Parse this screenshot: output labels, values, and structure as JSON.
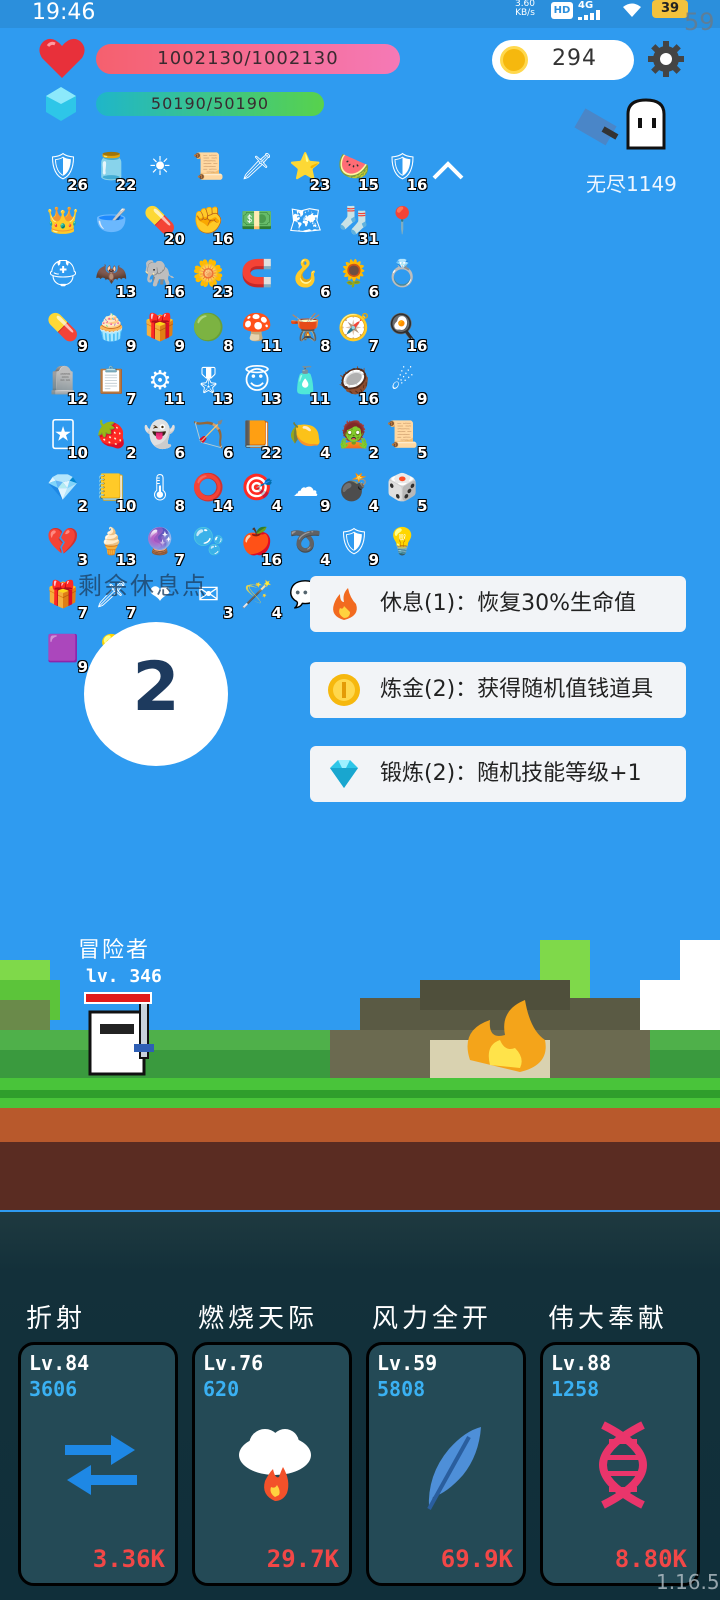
{
  "status_bar": {
    "time": "19:46",
    "net_speed": "3.60 KB/s",
    "hd": "HD",
    "network": "4G",
    "battery": "39",
    "fps": "59"
  },
  "player": {
    "hp": "1002130/1002130",
    "mp": "50190/50190",
    "coins": "294",
    "endless_label": "无尽1149"
  },
  "items": [
    {
      "icon": "shield-round-icon",
      "glyph": "🛡",
      "count": "26"
    },
    {
      "icon": "jam-jar-icon",
      "glyph": "🫙",
      "count": "22"
    },
    {
      "icon": "sun-icon",
      "glyph": "☀",
      "count": ""
    },
    {
      "icon": "scroll-icon",
      "glyph": "📜",
      "count": ""
    },
    {
      "icon": "sword-icon",
      "glyph": "🗡",
      "count": ""
    },
    {
      "icon": "star-card-icon",
      "glyph": "⭐",
      "count": "23"
    },
    {
      "icon": "watermelon-icon",
      "glyph": "🍉",
      "count": "15"
    },
    {
      "icon": "shield-icon",
      "glyph": "🛡",
      "count": "16"
    },
    {
      "icon": "crown-icon",
      "glyph": "👑",
      "count": ""
    },
    {
      "icon": "mortar-icon",
      "glyph": "🥣",
      "count": ""
    },
    {
      "icon": "capsule-icon",
      "glyph": "💊",
      "count": "20"
    },
    {
      "icon": "fist-icon",
      "glyph": "✊",
      "count": "16"
    },
    {
      "icon": "money-icon",
      "glyph": "💵",
      "count": ""
    },
    {
      "icon": "map-icon",
      "glyph": "🗺",
      "count": ""
    },
    {
      "icon": "sock-icon",
      "glyph": "🧦",
      "count": "31"
    },
    {
      "icon": "location-pin-icon",
      "glyph": "📍",
      "count": ""
    },
    {
      "icon": "helmet-icon",
      "glyph": "⛑",
      "count": ""
    },
    {
      "icon": "bat-icon",
      "glyph": "🦇",
      "count": "13"
    },
    {
      "icon": "elephant-icon",
      "glyph": "🐘",
      "count": "16"
    },
    {
      "icon": "flower-icon",
      "glyph": "🌼",
      "count": "23"
    },
    {
      "icon": "magnet-icon",
      "glyph": "🧲",
      "count": ""
    },
    {
      "icon": "hook-icon",
      "glyph": "🪝",
      "count": "6"
    },
    {
      "icon": "sunflower-icon",
      "glyph": "🌻",
      "count": "6"
    },
    {
      "icon": "ring-icon",
      "glyph": "💍",
      "count": ""
    },
    {
      "icon": "pill-icon",
      "glyph": "💊",
      "count": "9"
    },
    {
      "icon": "cupcake-icon",
      "glyph": "🧁",
      "count": "9"
    },
    {
      "icon": "purple-box-icon",
      "glyph": "🎁",
      "count": "9"
    },
    {
      "icon": "green-figure-icon",
      "glyph": "🟢",
      "count": "8"
    },
    {
      "icon": "mushroom-icon",
      "glyph": "🍄",
      "count": "11"
    },
    {
      "icon": "cauldron-icon",
      "glyph": "🫕",
      "count": "8"
    },
    {
      "icon": "compass-icon",
      "glyph": "🧭",
      "count": "7"
    },
    {
      "icon": "egg-icon",
      "glyph": "🍳",
      "count": "16"
    },
    {
      "icon": "tombstone-icon",
      "glyph": "🪦",
      "count": "12"
    },
    {
      "icon": "clipboard-icon",
      "glyph": "📋",
      "count": "7"
    },
    {
      "icon": "mace-icon",
      "glyph": "⚙",
      "count": "11"
    },
    {
      "icon": "badge-icon",
      "glyph": "🎖",
      "count": "13"
    },
    {
      "icon": "halo-icon",
      "glyph": "😇",
      "count": "13"
    },
    {
      "icon": "potion-bottle-icon",
      "glyph": "🧴",
      "count": "11"
    },
    {
      "icon": "coconut-icon",
      "glyph": "🥥",
      "count": "16"
    },
    {
      "icon": "meteor-icon",
      "glyph": "☄",
      "count": "9"
    },
    {
      "icon": "card-icon",
      "glyph": "🃏",
      "count": "10"
    },
    {
      "icon": "strawberry-icon",
      "glyph": "🍓",
      "count": "2"
    },
    {
      "icon": "ghost-icon",
      "glyph": "👻",
      "count": "6"
    },
    {
      "icon": "bow-icon",
      "glyph": "🏹",
      "count": "6"
    },
    {
      "icon": "book-icon",
      "glyph": "📙",
      "count": "22"
    },
    {
      "icon": "lime-icon",
      "glyph": "🍋",
      "count": "4"
    },
    {
      "icon": "zombie-icon",
      "glyph": "🧟",
      "count": "2"
    },
    {
      "icon": "blue-scroll-icon",
      "glyph": "📜",
      "count": "5"
    },
    {
      "icon": "gem-icon",
      "glyph": "💎",
      "count": "2"
    },
    {
      "icon": "note-icon",
      "glyph": "📒",
      "count": "10"
    },
    {
      "icon": "thermometer-icon",
      "glyph": "🌡",
      "count": "8"
    },
    {
      "icon": "target-ring-icon",
      "glyph": "⭕",
      "count": "14"
    },
    {
      "icon": "crosshair-icon",
      "glyph": "🎯",
      "count": "4"
    },
    {
      "icon": "cloud-icon",
      "glyph": "☁",
      "count": "9"
    },
    {
      "icon": "grenade-icon",
      "glyph": "💣",
      "count": "4"
    },
    {
      "icon": "dice-icon",
      "glyph": "🎲",
      "count": "5"
    },
    {
      "icon": "broken-heart-icon",
      "glyph": "💔",
      "count": "3"
    },
    {
      "icon": "ice-cream-icon",
      "glyph": "🍦",
      "count": "13"
    },
    {
      "icon": "crystal-ball-icon",
      "glyph": "🔮",
      "count": "7"
    },
    {
      "icon": "blue-orb-icon",
      "glyph": "🫧",
      "count": ""
    },
    {
      "icon": "apple-icon",
      "glyph": "🍎",
      "count": "16"
    },
    {
      "icon": "noose-icon",
      "glyph": "➰",
      "count": "4"
    },
    {
      "icon": "purple-shield-icon",
      "glyph": "🛡",
      "count": "9"
    },
    {
      "icon": "light-bulb-icon",
      "glyph": "💡",
      "count": ""
    },
    {
      "icon": "gift-icon",
      "glyph": "🎁",
      "count": "7"
    },
    {
      "icon": "blade-icon",
      "glyph": "🗡",
      "count": "7"
    },
    {
      "icon": "heart-icon",
      "glyph": "❤",
      "count": ""
    },
    {
      "icon": "envelope-icon",
      "glyph": "✉",
      "count": "3"
    },
    {
      "icon": "magic-wand-icon",
      "glyph": "🪄",
      "count": "4"
    },
    {
      "icon": "chat-bubble-icon",
      "glyph": "💬",
      "count": ""
    },
    {
      "icon": "flame-icon",
      "glyph": "🔥",
      "count": ""
    },
    {
      "icon": "",
      "glyph": "",
      "count": ""
    },
    {
      "icon": "striped-card-icon",
      "glyph": "🟪",
      "count": "9"
    },
    {
      "icon": "glowing-bulb-icon",
      "glyph": "💡",
      "count": ""
    }
  ],
  "rest": {
    "title": "剩余休息点",
    "remaining": "2"
  },
  "options": [
    {
      "label": "休息(1)：恢复30%生命值",
      "icon": "fire-icon"
    },
    {
      "label": "炼金(2)：获得随机值钱道具",
      "icon": "gold-coin-icon"
    },
    {
      "label": "锻炼(2)：随机技能等级+1",
      "icon": "diamond-icon"
    }
  ],
  "adventurer": {
    "name": "冒险者",
    "level": "lv. 346"
  },
  "skills": [
    {
      "name": "折射",
      "level": "Lv.84",
      "points": "3606",
      "cost": "3.36K",
      "icon": "swap-arrows-icon"
    },
    {
      "name": "燃烧天际",
      "level": "Lv.76",
      "points": "620",
      "cost": "29.7K",
      "icon": "fire-cloud-icon"
    },
    {
      "name": "风力全开",
      "level": "Lv.59",
      "points": "5808",
      "cost": "69.9K",
      "icon": "feather-icon"
    },
    {
      "name": "伟大奉献",
      "level": "Lv.88",
      "points": "1258",
      "cost": "8.80K",
      "icon": "dna-icon"
    }
  ],
  "version": "1.16.5",
  "colors": {
    "sky": "#2f9bf0",
    "hp_start": "#f5606e",
    "mp_start": "#1fb6c9",
    "cost_red": "#f24747",
    "points_blue": "#3ab0f2"
  }
}
